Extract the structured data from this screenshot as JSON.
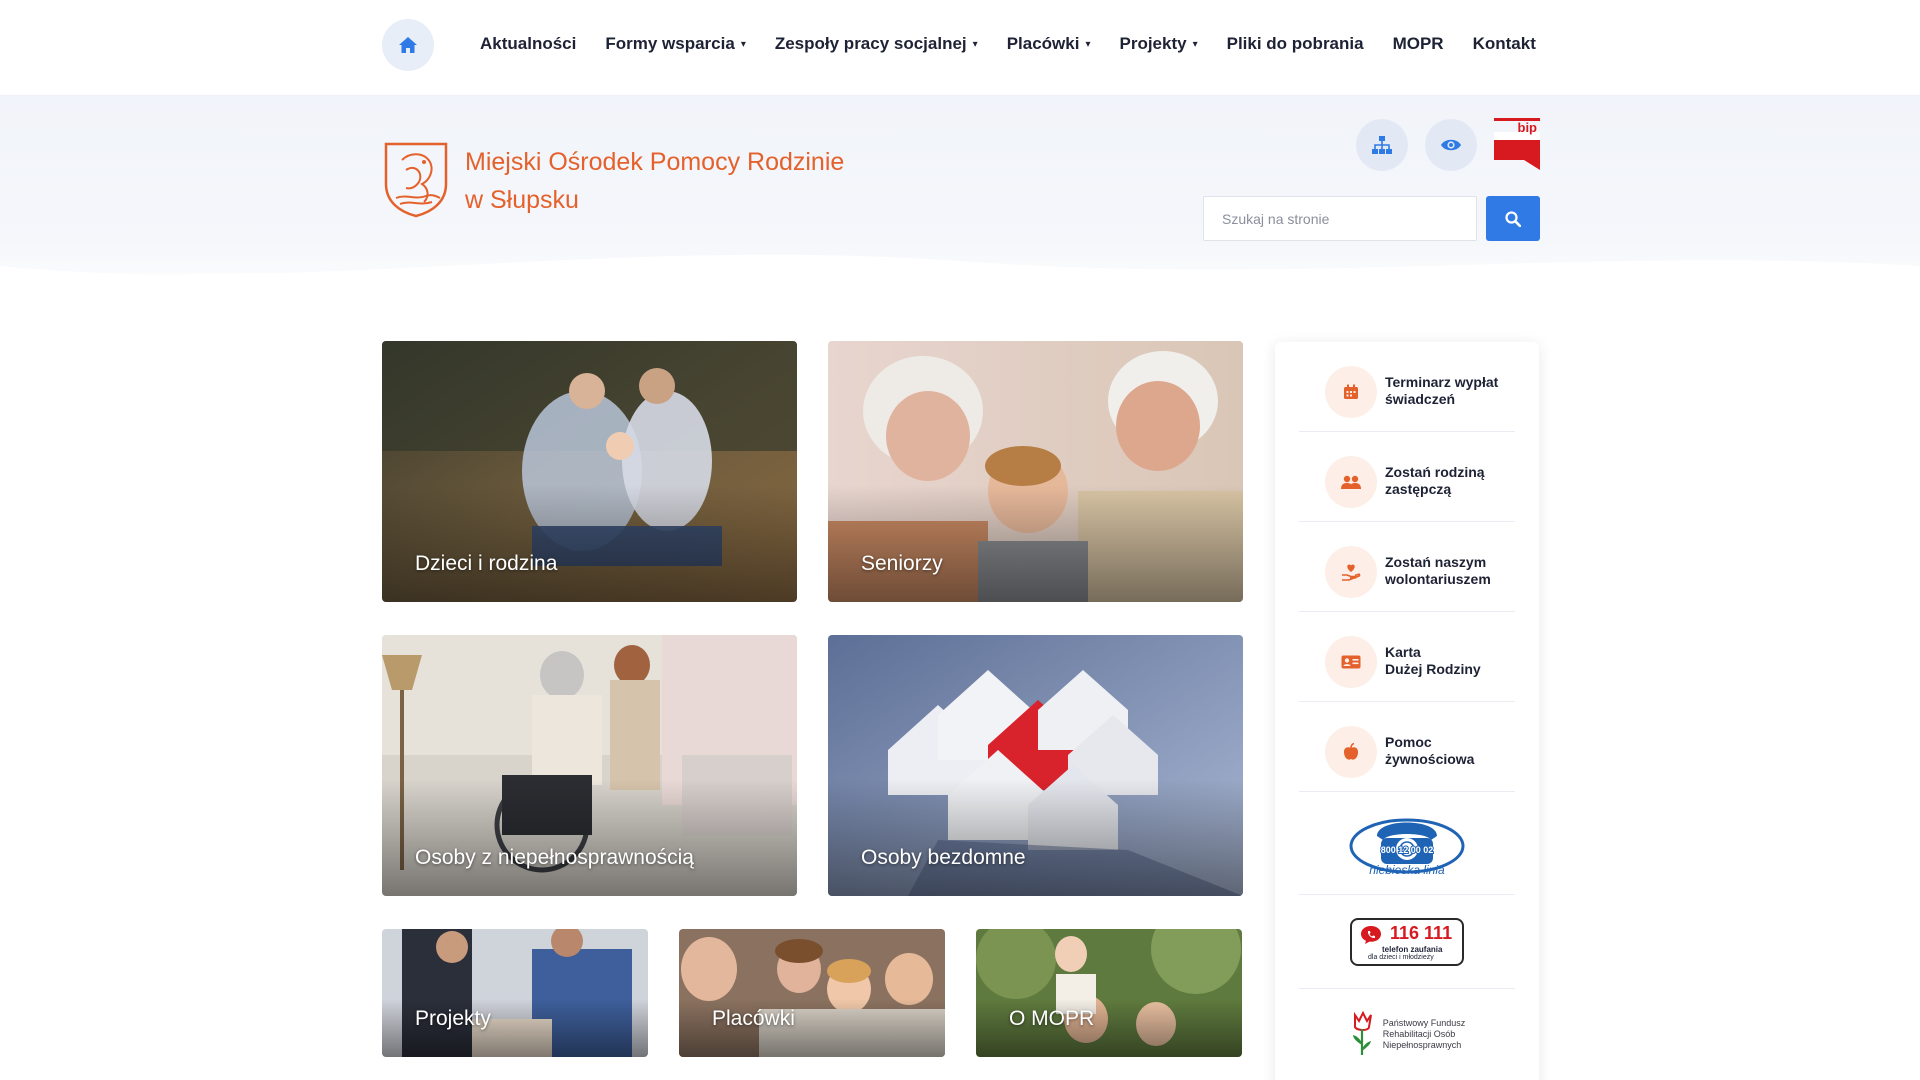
{
  "nav": {
    "home_icon": "home-icon",
    "items": [
      {
        "label": "Aktualności",
        "dropdown": false
      },
      {
        "label": "Formy wsparcia",
        "dropdown": true
      },
      {
        "label": "Zespoły pracy socjalnej",
        "dropdown": true
      },
      {
        "label": "Placówki",
        "dropdown": true
      },
      {
        "label": "Projekty",
        "dropdown": true
      },
      {
        "label": "Pliki do pobrania",
        "dropdown": false
      },
      {
        "label": "MOPR",
        "dropdown": false
      },
      {
        "label": "Kontakt",
        "dropdown": false
      }
    ],
    "chevron": "⌄"
  },
  "header": {
    "org_line1": "Miejski Ośrodek Pomocy Rodzinie",
    "org_line2": "w Słupsku",
    "bip_label": "bip",
    "search": {
      "placeholder": "Szukaj na stronie",
      "value": ""
    }
  },
  "tiles": [
    {
      "label": "Dzieci i rodzina"
    },
    {
      "label": "Seniorzy"
    },
    {
      "label": "Osoby z niepełnosprawnością"
    },
    {
      "label": "Osoby bezdomne"
    },
    {
      "label": "Projekty"
    },
    {
      "label": "Placówki"
    },
    {
      "label": "O MOPR"
    }
  ],
  "sidebar": {
    "links": [
      {
        "line1": "Terminarz wypłat",
        "line2": "świadczeń",
        "icon": "calendar-icon"
      },
      {
        "line1": "Zostań rodziną",
        "line2": "zastępczą",
        "icon": "users-icon"
      },
      {
        "line1": "Zostań naszym",
        "line2": "wolontariuszem",
        "icon": "hand-heart-icon"
      },
      {
        "line1": "Karta",
        "line2": "Dużej Rodziny",
        "icon": "id-card-icon"
      },
      {
        "line1": "Pomoc",
        "line2": "żywnościowa",
        "icon": "apple-icon"
      }
    ],
    "badges": {
      "niebieska_number": "800 12 00 02",
      "niebieska_name": "niebieska linia",
      "helpline_number": "116 111",
      "helpline_line1": "telefon zaufania",
      "helpline_line2": "dla dzieci i młodzieży",
      "pfron_line1": "Państwowy Fundusz",
      "pfron_line2": "Rehabilitacji Osób",
      "pfron_line3": "Niepełnosprawnych"
    }
  },
  "colors": {
    "accent_orange": "#e5612b",
    "accent_blue": "#2f7ae5",
    "text_dark": "#1e2235"
  }
}
